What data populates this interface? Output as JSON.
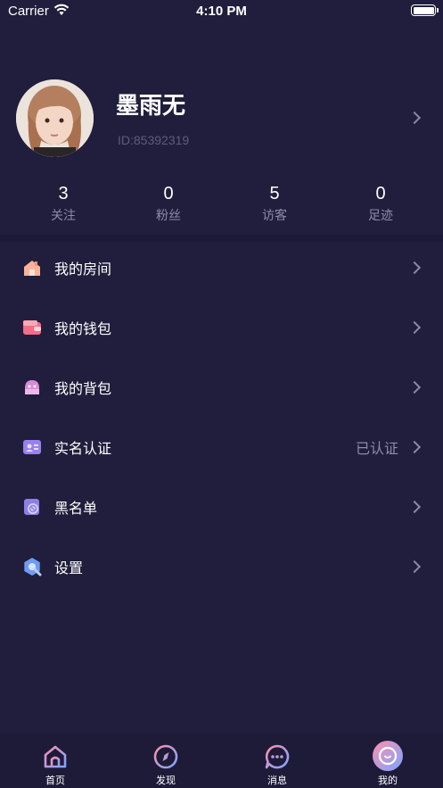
{
  "status_bar": {
    "carrier": "Carrier",
    "time": "4:10 PM"
  },
  "profile": {
    "name": "墨雨无",
    "id_text": "ID:85392319"
  },
  "stats": [
    {
      "value": "3",
      "label": "关注"
    },
    {
      "value": "0",
      "label": "粉丝"
    },
    {
      "value": "5",
      "label": "访客"
    },
    {
      "value": "0",
      "label": "足迹"
    }
  ],
  "menu": [
    {
      "label": "我的房间",
      "icon": "room-icon",
      "value": ""
    },
    {
      "label": "我的钱包",
      "icon": "wallet-icon",
      "value": ""
    },
    {
      "label": "我的背包",
      "icon": "backpack-icon",
      "value": ""
    },
    {
      "label": "实名认证",
      "icon": "id-card-icon",
      "value": "已认证"
    },
    {
      "label": "黑名单",
      "icon": "blacklist-icon",
      "value": ""
    },
    {
      "label": "设置",
      "icon": "settings-icon",
      "value": ""
    }
  ],
  "tabs": [
    {
      "label": "首页",
      "icon": "home-icon"
    },
    {
      "label": "发现",
      "icon": "compass-icon"
    },
    {
      "label": "消息",
      "icon": "message-icon"
    },
    {
      "label": "我的",
      "icon": "profile-icon",
      "active": true
    }
  ],
  "colors": {
    "background": "#201e3c",
    "tab_bar": "#1d1b38",
    "muted_text": "#8d8baa",
    "id_text": "#5e5c7c"
  }
}
